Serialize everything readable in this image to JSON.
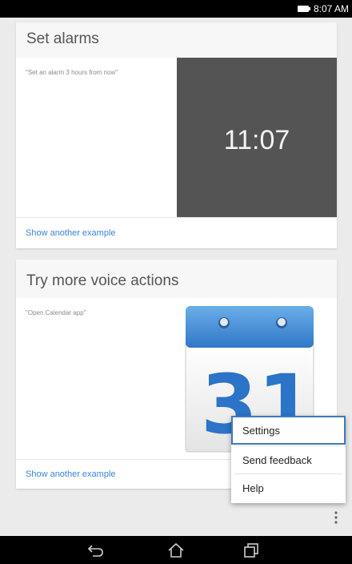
{
  "status_bar": {
    "time": "8:07 AM",
    "battery_icon": "battery-icon"
  },
  "cards": [
    {
      "title": "Set alarms",
      "example": "\"Set an alarm 3 hours from now\"",
      "clock_time": "11:07",
      "link": "Show another example"
    },
    {
      "title": "Try more voice actions",
      "example": "\"Open Calendar app\"",
      "calendar_day": "31",
      "link": "Show another example"
    }
  ],
  "menu": {
    "items": [
      {
        "label": "Settings",
        "selected": true
      },
      {
        "label": "Send feedback"
      },
      {
        "label": "Help"
      }
    ]
  },
  "nav": {
    "back": "back-icon",
    "home": "home-icon",
    "recents": "recents-icon"
  },
  "colors": {
    "link": "#3d84d8",
    "clock_bg": "#545454",
    "selected_border": "#3d7ab8"
  }
}
